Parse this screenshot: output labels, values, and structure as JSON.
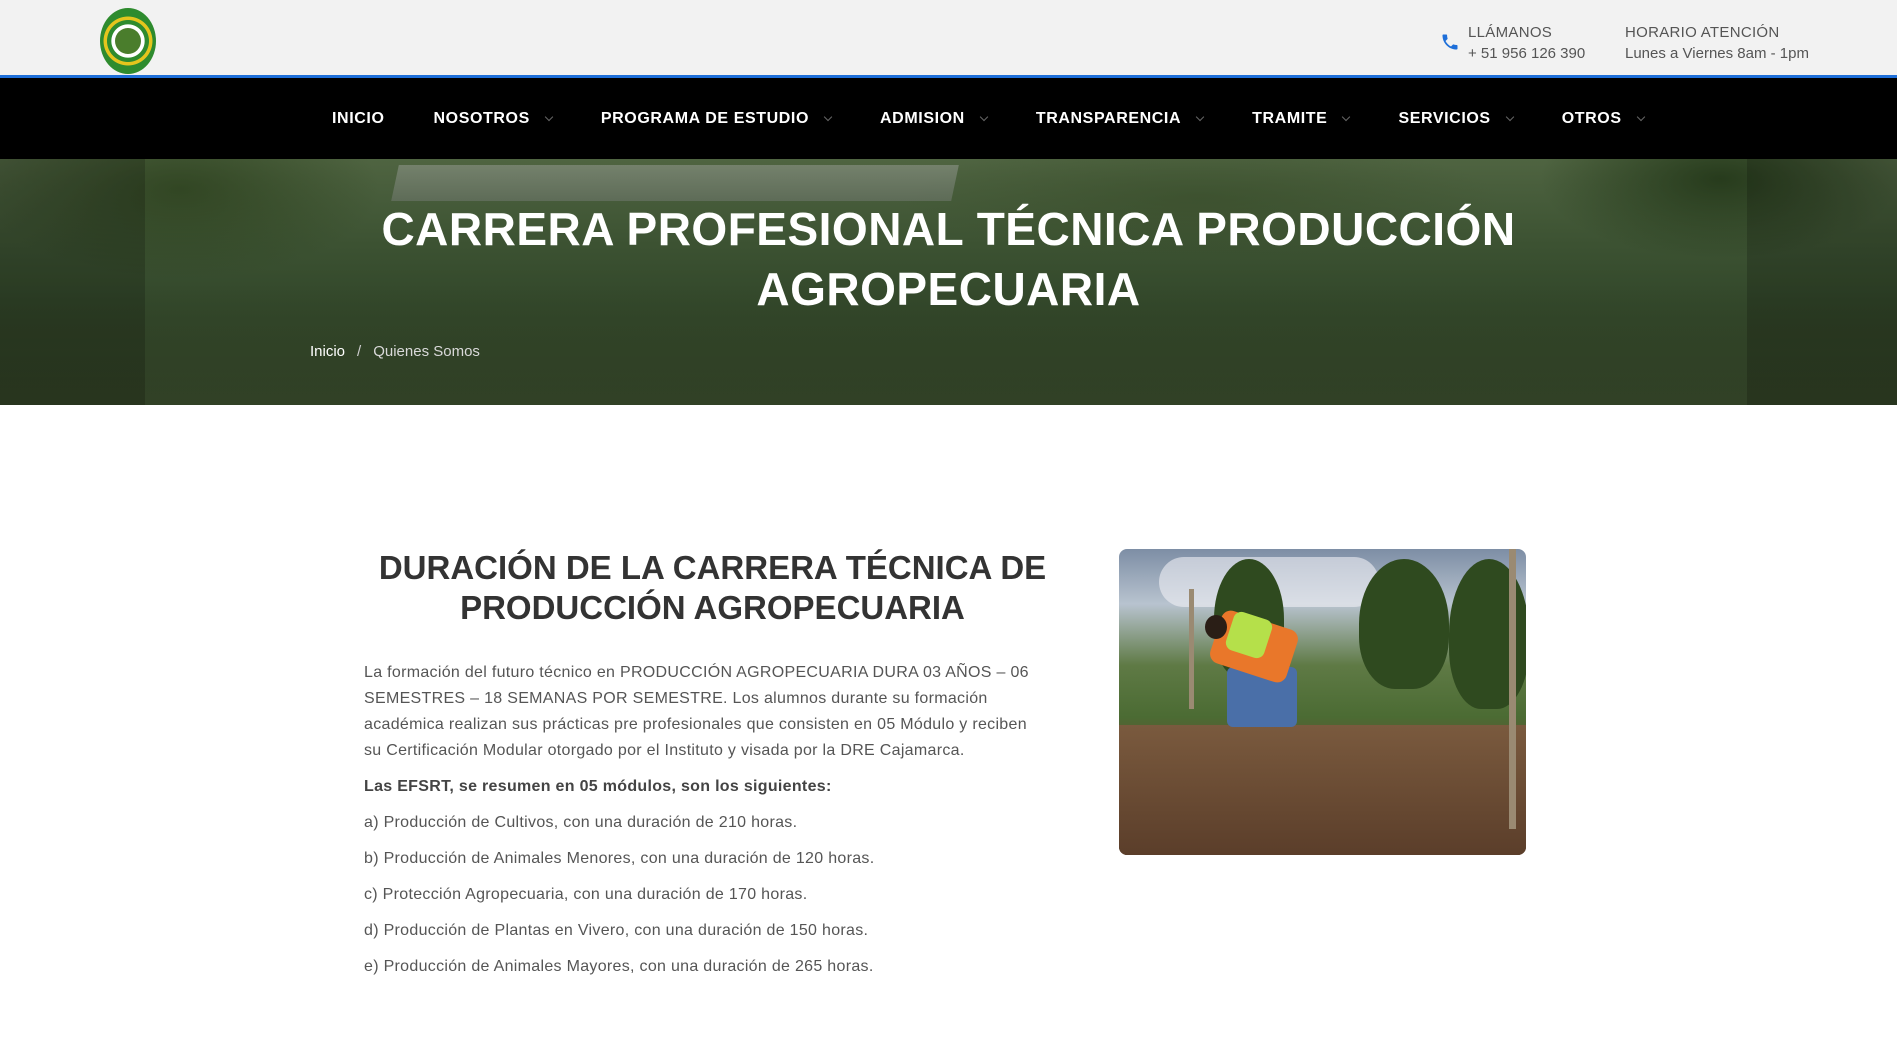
{
  "header": {
    "contact_phone": {
      "title": "LLÁMANOS",
      "value": "+ 51 956 126 390"
    },
    "contact_hours": {
      "title": "HORARIO ATENCIÓN",
      "value": "Lunes a Viernes 8am - 1pm"
    },
    "accent_color": "#1e6fd9"
  },
  "nav": {
    "items": [
      {
        "label": "INICIO",
        "has_dropdown": false
      },
      {
        "label": "NOSOTROS",
        "has_dropdown": true
      },
      {
        "label": "PROGRAMA DE ESTUDIO",
        "has_dropdown": true
      },
      {
        "label": "ADMISION",
        "has_dropdown": true
      },
      {
        "label": "TRANSPARENCIA",
        "has_dropdown": true
      },
      {
        "label": "TRAMITE",
        "has_dropdown": true
      },
      {
        "label": "SERVICIOS",
        "has_dropdown": true
      },
      {
        "label": "OTROS",
        "has_dropdown": true
      }
    ]
  },
  "hero": {
    "title_line1": "CARRERA PROFESIONAL TÉCNICA PRODUCCIÓN",
    "title_line2": "AGROPECUARIA",
    "breadcrumb": {
      "home": "Inicio",
      "separator": "/",
      "current": "Quienes Somos"
    }
  },
  "content": {
    "title_line1": "DURACIÓN DE LA CARRERA TÉCNICA DE",
    "title_line2": "PRODUCCIÓN AGROPECUARIA",
    "intro": "La formación del futuro técnico en PRODUCCIÓN AGROPECUARIA DURA 03 AÑOS – 06 SEMESTRES – 18 SEMANAS POR SEMESTRE. Los alumnos durante su formación académica realizan sus prácticas pre profesionales que consisten en 05 Módulo y reciben su Certificación Modular otorgado por el Instituto y visada por la DRE Cajamarca.",
    "summary": "Las EFSRT, se resumen en 05 módulos, son los siguientes:",
    "modules": [
      "a) Producción de Cultivos, con una duración de 210 horas.",
      "b) Producción de Animales Menores, con una duración de 120 horas.",
      "c) Protección Agropecuaria, con una duración de 170 horas.",
      "d) Producción de Plantas en Vivero, con una duración de 150 horas.",
      "e) Producción de Animales Mayores, con una duración de 265 horas."
    ]
  }
}
